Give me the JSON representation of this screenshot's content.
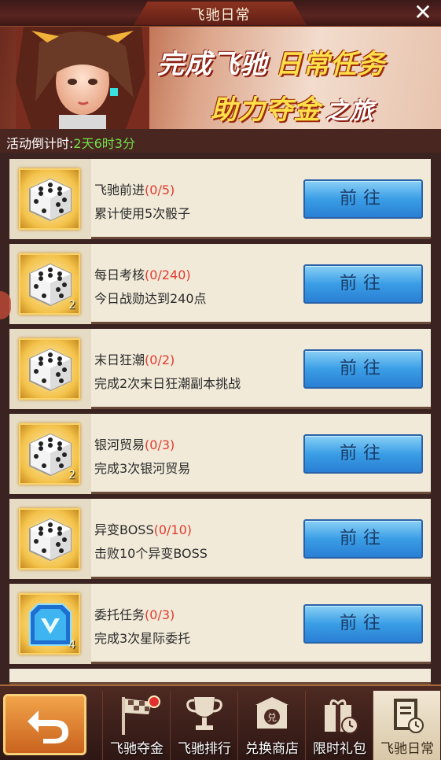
{
  "title": "飞驰日常",
  "close_icon": "close-icon",
  "banner": {
    "line1_a": "完成飞驰",
    "line1_b": "日常任务",
    "line2_a": "助力夺金",
    "line2_b": "之旅"
  },
  "countdown": {
    "label": "活动倒计时:",
    "value": "2天6时3分"
  },
  "tasks": [
    {
      "name": "飞驰前进",
      "progress": "(0/5)",
      "desc": "累计使用5次骰子",
      "reward_icon": "dice-icon",
      "qty": "",
      "button": "前往"
    },
    {
      "name": "每日考核",
      "progress": "(0/240)",
      "desc": "今日战勋达到240点",
      "reward_icon": "dice-icon",
      "qty": "2",
      "button": "前往"
    },
    {
      "name": "末日狂潮",
      "progress": "(0/2)",
      "desc": "完成2次末日狂潮副本挑战",
      "reward_icon": "dice-icon",
      "qty": "",
      "button": "前往"
    },
    {
      "name": "银河贸易",
      "progress": "(0/3)",
      "desc": "完成3次银河贸易",
      "reward_icon": "dice-icon",
      "qty": "2",
      "button": "前往"
    },
    {
      "name": "异变BOSS",
      "progress": "(0/10)",
      "desc": "击败10个异变BOSS",
      "reward_icon": "dice-icon",
      "qty": "",
      "button": "前往"
    },
    {
      "name": "委托任务",
      "progress": "(0/3)",
      "desc": "完成3次星际委托",
      "reward_icon": "blue-crystal-card-icon",
      "qty": "4",
      "button": "前往"
    }
  ],
  "nav": {
    "back_icon": "back-arrow-icon",
    "items": [
      {
        "label": "飞驰夺金",
        "icon": "checkered-flag-icon",
        "badge": true
      },
      {
        "label": "飞驰排行",
        "icon": "trophy-icon",
        "badge": false
      },
      {
        "label": "兑换商店",
        "icon": "shop-icon",
        "badge": false
      },
      {
        "label": "限时礼包",
        "icon": "gift-clock-icon",
        "badge": false
      },
      {
        "label": "飞驰日常",
        "icon": "clipboard-clock-icon",
        "badge": false,
        "active": true
      }
    ]
  },
  "colors": {
    "progress_red": "#e23b2e",
    "countdown_green": "#6fe04a",
    "button_blue": "#3a9ee6",
    "banner_yellow": "#ffe04a"
  }
}
